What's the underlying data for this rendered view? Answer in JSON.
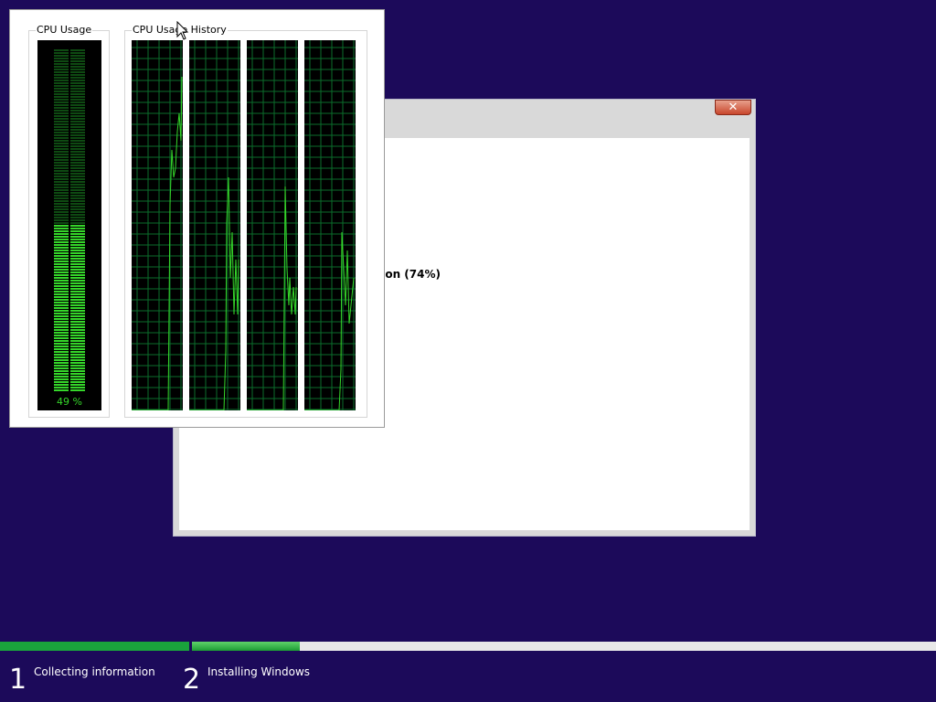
{
  "setup_window": {
    "close_label": "✕",
    "status_text": "ation (74%)"
  },
  "cpu_monitor": {
    "usage_label": "CPU Usage",
    "usage_percent_text": "49 %",
    "usage_fraction": 0.49,
    "history_label": "CPU Usage History",
    "core_count": 4,
    "colors": {
      "graph": "#35d62a",
      "grid": "#0b6e2c",
      "background": "#000000"
    }
  },
  "progress": {
    "steps": [
      {
        "number": "1",
        "label": "Collecting information",
        "fraction": 1.0
      },
      {
        "number": "2",
        "label": "Installing Windows",
        "fraction": 0.145
      }
    ],
    "colors": {
      "fill": "#1aa33c",
      "track": "#e8e8e8"
    }
  },
  "colors": {
    "desktop": "#1c0a5a"
  }
}
